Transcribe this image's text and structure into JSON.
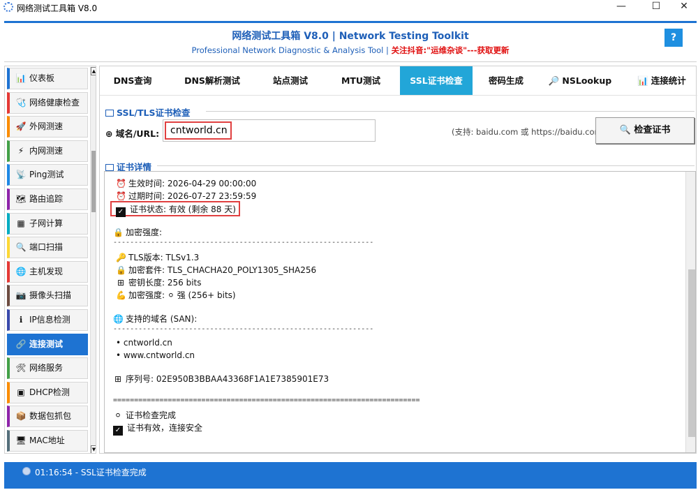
{
  "window": {
    "title": "网络测试工具箱 V8.0",
    "min_icon": "—",
    "max_icon": "☐",
    "close_icon": "✕"
  },
  "header": {
    "title": "网络测试工具箱 V8.0 | Network Testing Toolkit",
    "subtitle": "Professional Network Diagnostic & Analysis Tool |",
    "promo": "关注抖音:\"运维杂谈\"---获取更新",
    "help": "?"
  },
  "sidebar": {
    "items": [
      {
        "icon": "📊",
        "label": "仪表板"
      },
      {
        "icon": "🩺",
        "label": "网络健康检查"
      },
      {
        "icon": "🚀",
        "label": "外网测速"
      },
      {
        "icon": "⚡",
        "label": "内网测速"
      },
      {
        "icon": "📡",
        "label": "Ping测试"
      },
      {
        "icon": "🗺",
        "label": "路由追踪"
      },
      {
        "icon": "▦",
        "label": "子网计算"
      },
      {
        "icon": "🔍",
        "label": "端口扫描"
      },
      {
        "icon": "🌐",
        "label": "主机发现"
      },
      {
        "icon": "📷",
        "label": "摄像头扫描"
      },
      {
        "icon": "ℹ",
        "label": "IP信息检测"
      },
      {
        "icon": "🔗",
        "label": "连接测试"
      },
      {
        "icon": "🛠",
        "label": "网络服务"
      },
      {
        "icon": "▣",
        "label": "DHCP检测"
      },
      {
        "icon": "📦",
        "label": "数据包抓包"
      },
      {
        "icon": "🖥",
        "label": "MAC地址"
      }
    ],
    "active_index": 11,
    "accent_colors": [
      "#1e73d2",
      "#e53935",
      "#fb8c00",
      "#43a047",
      "#1e88e5",
      "#8e24aa",
      "#00acc1",
      "#fdd835",
      "#e53935",
      "#6d4c41",
      "#3949ab",
      "#1e73d2",
      "#43a047",
      "#fb8c00",
      "#8e24aa",
      "#546e7a"
    ]
  },
  "tabs": [
    {
      "label": "DNS查询",
      "icon": ""
    },
    {
      "label": "DNS解析测试",
      "icon": ""
    },
    {
      "label": "站点测试",
      "icon": ""
    },
    {
      "label": "MTU测试",
      "icon": ""
    },
    {
      "label": "SSL证书检查",
      "icon": ""
    },
    {
      "label": "密码生成",
      "icon": ""
    },
    {
      "label": "NSLookup",
      "icon": "🔎"
    },
    {
      "label": "连接统计",
      "icon": "📊"
    }
  ],
  "active_tab": 4,
  "ssl_group": {
    "title": "SSL/TLS证书检查",
    "domain_label": "域名/URL:",
    "domain_value": "cntworld.cn",
    "hint": "(支持: baidu.com 或 https://baidu.com)",
    "check_button": "检查证书"
  },
  "details": {
    "title": "证书详情",
    "valid_from": "生效时间: 2026-04-29 00:00:00",
    "valid_to": "过期时间: 2026-07-27 23:59:59",
    "status": "证书状态: 有效 (剩余 88 天)",
    "strength_heading": "加密强度:",
    "separator_short": "--------------------------------------------------------------",
    "tls_version": "TLS版本: TLSv1.3",
    "cipher": "加密套件: TLS_CHACHA20_POLY1305_SHA256",
    "key_length": "密钥长度: 256 bits",
    "strength": "加密强度: ⚪ 强 (256+ bits)",
    "san_heading": "支持的域名 (SAN):",
    "san": [
      "• cntworld.cn",
      "• www.cntworld.cn"
    ],
    "serial": "序列号: 02E950B3BBAA43368F1A1E7385901E73",
    "separator_long": "=========================================================================",
    "done": "证书检查完成",
    "valid_msg": "证书有效，连接安全"
  },
  "status": {
    "text": "01:16:54 - SSL证书检查完成"
  },
  "colors": {
    "accent": "#1e73d2",
    "tab_active": "#22a6d8",
    "highlight": "#e04040",
    "promo": "#e01010"
  }
}
